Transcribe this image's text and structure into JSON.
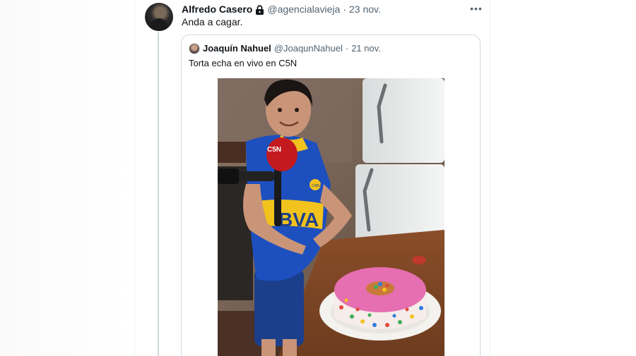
{
  "tweet": {
    "author_name": "Alfredo Casero",
    "author_handle": "@agencialavieja",
    "separator": "·",
    "date": "23 nov.",
    "text": "Anda a cagar.",
    "more_label": "•••"
  },
  "quoted_tweet": {
    "author_name": "Joaquín Nahuel",
    "author_handle": "@JoaqunNahuel",
    "separator": "·",
    "date": "21 nov.",
    "text": "Torta echa en vivo en C5N",
    "image": {
      "mic_flag_text": "C5N",
      "jersey_text": "BVA",
      "badge_text": "CABJ"
    }
  }
}
